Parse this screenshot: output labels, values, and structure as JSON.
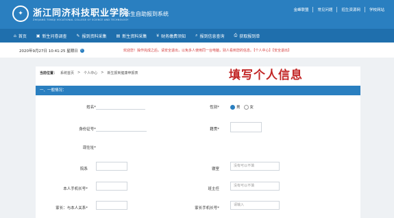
{
  "header": {
    "logo_glyph": "✦",
    "school_name": "浙江同济科技职业学院",
    "school_sub": "ZHEJIANG TONGJI VOCATIONAL COLLEGE OF SCIENCE AND TECHNOLOGY",
    "system_title": "新生自助报到系统",
    "links": [
      "金峰联盟",
      "常见问题",
      "招生资源网",
      "学校网站"
    ]
  },
  "nav": {
    "items": [
      {
        "icon": "⌂",
        "label": "首页"
      },
      {
        "icon": "▣",
        "label": "新生问卷调查"
      },
      {
        "icon": "✎",
        "label": "报到资料采集"
      },
      {
        "icon": "▤",
        "label": "新生资料采集"
      },
      {
        "icon": "¥",
        "label": "财务缴费须知"
      },
      {
        "icon": "⌕",
        "label": "报到信息查询"
      },
      {
        "icon": "⎙",
        "label": "获取报到单"
      }
    ]
  },
  "status": {
    "datetime": "2020年9月27日 10:41:25 星期日",
    "welcome": "欢迎您！操作完成之后，请安全退出，以免多人使用同一台电脑，别人看到您的信息。",
    "link_personal": "【个人中心】",
    "link_logout": "【安全退出】"
  },
  "breadcrumb": {
    "prefix": "当前位置：",
    "items": [
      "系统首页",
      ">",
      "个人中心",
      ">",
      "新生报到健康申报表"
    ]
  },
  "overlay_title": "填写个人信息",
  "section": {
    "title": "一、一般情况："
  },
  "form": {
    "name_label": "姓名*",
    "gender_label": "性别*",
    "gender_options": [
      "男",
      "女"
    ],
    "gender_selected": "男",
    "id_label": "身份证号*",
    "nation_label": "籍贯*",
    "address_label": "现住址*",
    "dept_label": "院系",
    "dorm_label": "寝室",
    "dorm_placeholder": "没有可以不填",
    "phone_label": "本人手机长号*",
    "teacher_label": "班主任",
    "teacher_placeholder": "没有可以不填",
    "parent_label": "家长：与本人关系*",
    "parent_phone_label": "家长手机长号*",
    "parent_phone_placeholder": "请输入"
  }
}
